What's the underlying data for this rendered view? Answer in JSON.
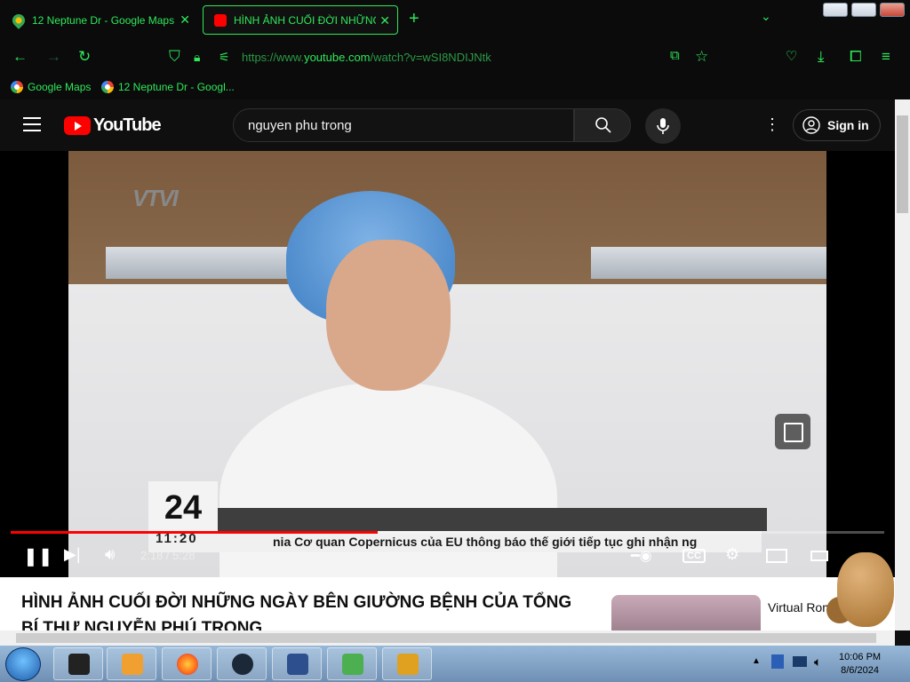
{
  "browser": {
    "tabs": [
      {
        "label": "12 Neptune Dr - Google Maps",
        "icon": "map-pin-icon",
        "active": false
      },
      {
        "label": "HÌNH ẢNH CUỐI ĐỜI NHỮNG",
        "icon": "youtube-icon",
        "active": true
      }
    ],
    "url_prefix": "https://www.",
    "url_domain": "youtube.com",
    "url_path": "/watch?v=wSI8NDIJNtk",
    "bookmarks": [
      "Google Maps",
      "12 Neptune Dr - Googl..."
    ]
  },
  "youtube": {
    "logo_text": "YouTube",
    "search_value": "nguyen phu trong",
    "signin_label": "Sign in",
    "video": {
      "channel_logo": "VTVI",
      "logo24": "24",
      "clock": "11:20",
      "ticker_text": "nia      Cơ quan Copernicus của EU thông báo thế giới tiếp tục ghi nhận ng",
      "current_time": "2:18",
      "duration": "5:28",
      "time_display": "2:18 / 5:28",
      "progress_fraction": 0.42
    },
    "title": "HÌNH ẢNH CUỐI ĐỜI NHỮNG NGÀY BÊN GIƯỜNG BỆNH CỦA TỔNG BÍ THƯ NGUYỄN PHÚ TRONG",
    "suggestion_title": "Virtual Romantic..."
  },
  "taskbar": {
    "time": "10:06 PM",
    "date": "8/6/2024"
  },
  "colors": {
    "accent": "#2ee85a",
    "youtube_red": "#ff0000"
  }
}
